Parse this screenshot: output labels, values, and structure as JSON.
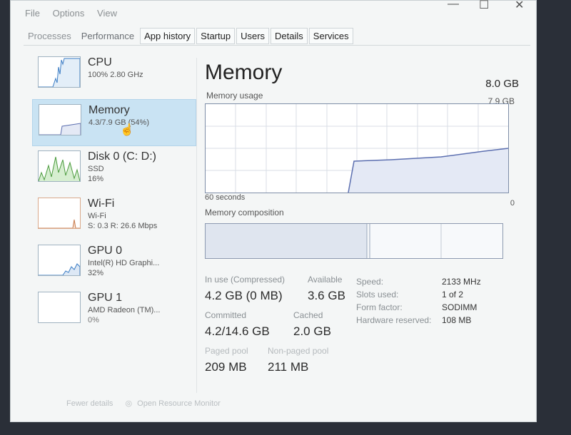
{
  "menu": [
    "File",
    "Options",
    "View"
  ],
  "window_controls": {
    "minimize": "—",
    "maximize": "☐",
    "close": "✕"
  },
  "tabs": [
    {
      "label": "Processes"
    },
    {
      "label": "Performance"
    },
    {
      "label": "App history"
    },
    {
      "label": "Startup"
    },
    {
      "label": "Users"
    },
    {
      "label": "Details"
    },
    {
      "label": "Services"
    }
  ],
  "sidebar": {
    "items": [
      {
        "title": "CPU",
        "sub1": "100% 2.80 GHz",
        "sub2": ""
      },
      {
        "title": "Memory",
        "sub1": "4.3/7.9 GB (54%)",
        "sub2": ""
      },
      {
        "title": "Disk 0 (C: D:)",
        "sub1": "SSD",
        "sub2": "16%"
      },
      {
        "title": "Wi-Fi",
        "sub1": "Wi-Fi",
        "sub2": "S: 0.3 R: 26.6 Mbps"
      },
      {
        "title": "GPU 0",
        "sub1": "Intel(R) HD Graphi...",
        "sub2": "32%"
      },
      {
        "title": "GPU 1",
        "sub1": "AMD Radeon (TM)...",
        "sub2": "0%"
      }
    ]
  },
  "main": {
    "title": "Memory",
    "total": "8.0 GB",
    "usage_label": "Memory usage",
    "usage_max": "7.9 GB",
    "time_label": "60 seconds",
    "zero_label": "0",
    "composition_label": "Memory composition",
    "stats": {
      "in_use_label": "In use (Compressed)",
      "in_use_value": "4.2 GB (0 MB)",
      "available_label": "Available",
      "available_value": "3.6 GB",
      "committed_label": "Committed",
      "committed_value": "4.2/14.6 GB",
      "cached_label": "Cached",
      "cached_value": "2.0 GB",
      "paged_label": "Paged pool",
      "paged_value": "209 MB",
      "nonpaged_label": "Non-paged pool",
      "nonpaged_value": "211 MB"
    },
    "specs": [
      {
        "label": "Speed:",
        "value": "2133 MHz"
      },
      {
        "label": "Slots used:",
        "value": "1 of 2"
      },
      {
        "label": "Form factor:",
        "value": "SODIMM"
      },
      {
        "label": "Hardware reserved:",
        "value": "108 MB"
      }
    ]
  },
  "footer": {
    "fewer_details": "Fewer details",
    "open_monitor": "Open Resource Monitor"
  },
  "colors": {
    "memory_line": "#5c6fb0",
    "memory_fill": "#e4e9f5",
    "grid": "#d8dde6",
    "selected": "#c9e3f3"
  }
}
